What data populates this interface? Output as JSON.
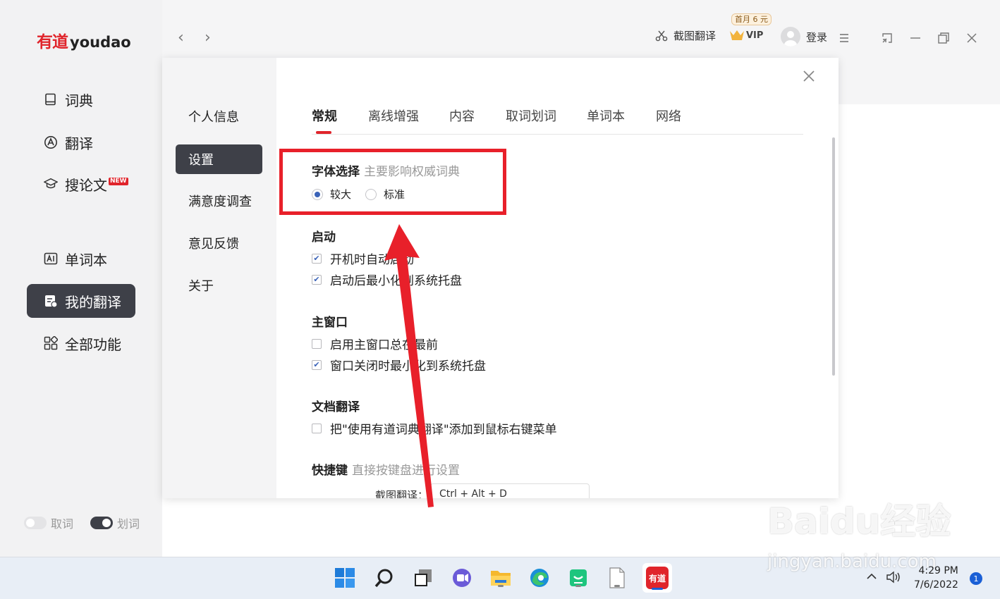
{
  "app": {
    "logo_cn": "有道",
    "logo_en": "youdao"
  },
  "sidebar": {
    "items": [
      {
        "label": "词典",
        "icon": "book-icon"
      },
      {
        "label": "翻译",
        "icon": "translate-icon"
      },
      {
        "label": "搜论文",
        "icon": "graduation-cap-icon",
        "badge": "NEW"
      },
      {
        "label": "单词本",
        "icon": "wordbook-icon"
      },
      {
        "label": "我的翻译",
        "icon": "my-translation-icon",
        "active": true
      },
      {
        "label": "全部功能",
        "icon": "grid-icon"
      }
    ],
    "toggles": [
      {
        "label": "取词",
        "on": false
      },
      {
        "label": "划词",
        "on": true
      }
    ]
  },
  "header": {
    "screenshot_translate": "截图翻译",
    "vip_promo": "首月 6 元",
    "vip_label": "VIP",
    "login": "登录"
  },
  "dialog": {
    "menu": [
      {
        "label": "个人信息"
      },
      {
        "label": "设置",
        "active": true
      },
      {
        "label": "满意度调查"
      },
      {
        "label": "意见反馈"
      },
      {
        "label": "关于"
      }
    ],
    "tabs": [
      {
        "label": "常规",
        "active": true
      },
      {
        "label": "离线增强"
      },
      {
        "label": "内容"
      },
      {
        "label": "取词划词"
      },
      {
        "label": "单词本"
      },
      {
        "label": "网络"
      }
    ],
    "font": {
      "title": "字体选择",
      "subtitle": "主要影响权威词典",
      "options": [
        {
          "label": "较大",
          "selected": true
        },
        {
          "label": "标准",
          "selected": false
        }
      ]
    },
    "startup": {
      "title": "启动",
      "options": [
        {
          "label": "开机时自动启动",
          "checked": true
        },
        {
          "label": "启动后最小化到系统托盘",
          "checked": true
        }
      ]
    },
    "main_window": {
      "title": "主窗口",
      "options": [
        {
          "label": "启用主窗口总在最前",
          "checked": false
        },
        {
          "label": "窗口关闭时最小化到系统托盘",
          "checked": true
        }
      ]
    },
    "doc_translate": {
      "title": "文档翻译",
      "options": [
        {
          "label": "把\"使用有道词典翻译\"添加到鼠标右键菜单",
          "checked": false
        }
      ]
    },
    "hotkeys": {
      "title": "快捷键",
      "subtitle": "直接按键盘进行设置",
      "first_label": "截图翻译：",
      "first_value": "Ctrl + Alt + D"
    }
  },
  "taskbar": {
    "time": "4:29 PM",
    "date": "7/6/2022",
    "notifications": "1",
    "youdao_label": "有道"
  },
  "watermark": {
    "main": "Baidu经验",
    "sub": "jingyan.baidu.com"
  },
  "annotation_color": "#e8202a",
  "accent_color": "#3b63b8"
}
